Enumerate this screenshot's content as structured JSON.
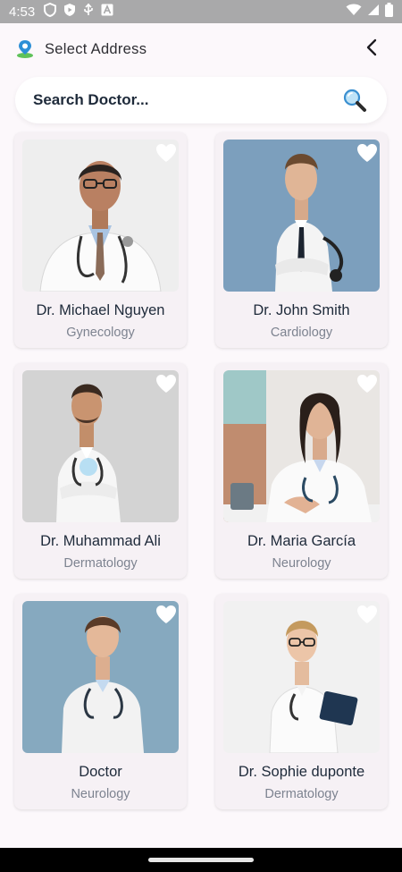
{
  "status_bar": {
    "time": "4:53",
    "left_icons": [
      "shield-icon",
      "shield-play-icon",
      "usb-icon",
      "font-a-icon"
    ],
    "right_icons": [
      "wifi-icon",
      "signal-icon",
      "battery-icon"
    ]
  },
  "app_bar": {
    "title": "Select Address",
    "leading_icon": "location-pin-icon",
    "trailing_icon": "chevron-left-icon"
  },
  "search": {
    "placeholder": "Search Doctor...",
    "icon": "magnifier-icon"
  },
  "theme": {
    "background": "#fcf8fb",
    "card_background": "#f6f1f5",
    "name_color": "#1e2a3a",
    "specialty_color": "#7d8390",
    "favorite_color": "#ffffff"
  },
  "doctors": [
    {
      "name": "Dr. Michael Nguyen",
      "specialty": "Gynecology",
      "favorite_icon": "heart-icon"
    },
    {
      "name": "Dr. John Smith",
      "specialty": "Cardiology",
      "favorite_icon": "heart-icon"
    },
    {
      "name": "Dr. Muhammad Ali",
      "specialty": "Dermatology",
      "favorite_icon": "heart-icon"
    },
    {
      "name": "Dr. Maria García",
      "specialty": "Neurology",
      "favorite_icon": "heart-icon"
    },
    {
      "name": "Doctor",
      "specialty": "Neurology",
      "favorite_icon": "heart-icon"
    },
    {
      "name": "Dr. Sophie duponte",
      "specialty": "Dermatology",
      "favorite_icon": "heart-icon"
    }
  ]
}
